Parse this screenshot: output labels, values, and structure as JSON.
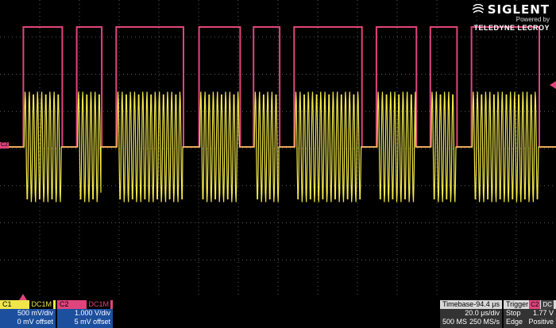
{
  "logo": {
    "brand": "SIGLENT",
    "powered_by": "Powered by",
    "partner": "TELEDYNE LECROY"
  },
  "colors": {
    "grid": "#5a5a5a",
    "ch1": "#f0e64a",
    "ch2": "#e0447c",
    "panel_blue": "#1c4f9e"
  },
  "markers": {
    "ch_label": "C2",
    "trigger_label": "T"
  },
  "ch1": {
    "label": "C1",
    "coupling": "DC1M",
    "vdiv": "500 mV/div",
    "offset": "0 mV offset"
  },
  "ch2": {
    "label": "C2",
    "coupling": "DC1M",
    "vdiv": "1.000 V/div",
    "offset": "5 mV offset"
  },
  "timebase": {
    "label": "Timebase",
    "delay": "-94.4 μs",
    "tdiv": "20.0 μs/div",
    "mem": "500 MS",
    "rate": "250 MS/s"
  },
  "trigger": {
    "label": "Trigger",
    "source": "C2",
    "coupling": "DC",
    "mode": "Stop",
    "level": "1.77 V",
    "type": "Edge",
    "slope": "Positive"
  },
  "pulses": [
    {
      "start": 0.042,
      "end": 0.112
    },
    {
      "start": 0.138,
      "end": 0.183
    },
    {
      "start": 0.209,
      "end": 0.33
    },
    {
      "start": 0.358,
      "end": 0.432
    },
    {
      "start": 0.456,
      "end": 0.503
    },
    {
      "start": 0.529,
      "end": 0.651
    },
    {
      "start": 0.677,
      "end": 0.749
    },
    {
      "start": 0.774,
      "end": 0.822
    },
    {
      "start": 0.848,
      "end": 0.97
    }
  ]
}
